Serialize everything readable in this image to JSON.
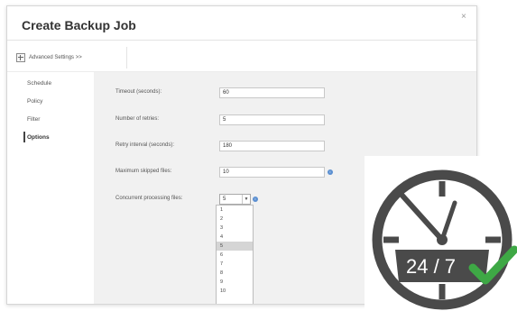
{
  "dialog": {
    "title": "Create Backup Job",
    "close_glyph": "×",
    "advanced_settings_label": "Advanced Settings >>"
  },
  "sidebar": {
    "items": [
      {
        "label": "Schedule",
        "active": false
      },
      {
        "label": "Policy",
        "active": false
      },
      {
        "label": "Filter",
        "active": false
      },
      {
        "label": "Options",
        "active": true
      }
    ]
  },
  "options": {
    "rows": [
      {
        "label": "Timeout (seconds):",
        "value": "60"
      },
      {
        "label": "Number of retries:",
        "value": "5"
      },
      {
        "label": "Retry interval (seconds):",
        "value": "180"
      },
      {
        "label": "Maximum skipped files:",
        "value": "10"
      },
      {
        "label": "Concurrent processing files:",
        "value": "5"
      }
    ],
    "dropdown_options": [
      "1",
      "2",
      "3",
      "4",
      "5",
      "6",
      "7",
      "8",
      "9",
      "10"
    ],
    "dropdown_selected": "5"
  },
  "badge": {
    "text": "24 / 7",
    "clock_color": "#4a4a4a",
    "check_color": "#3ea845"
  }
}
